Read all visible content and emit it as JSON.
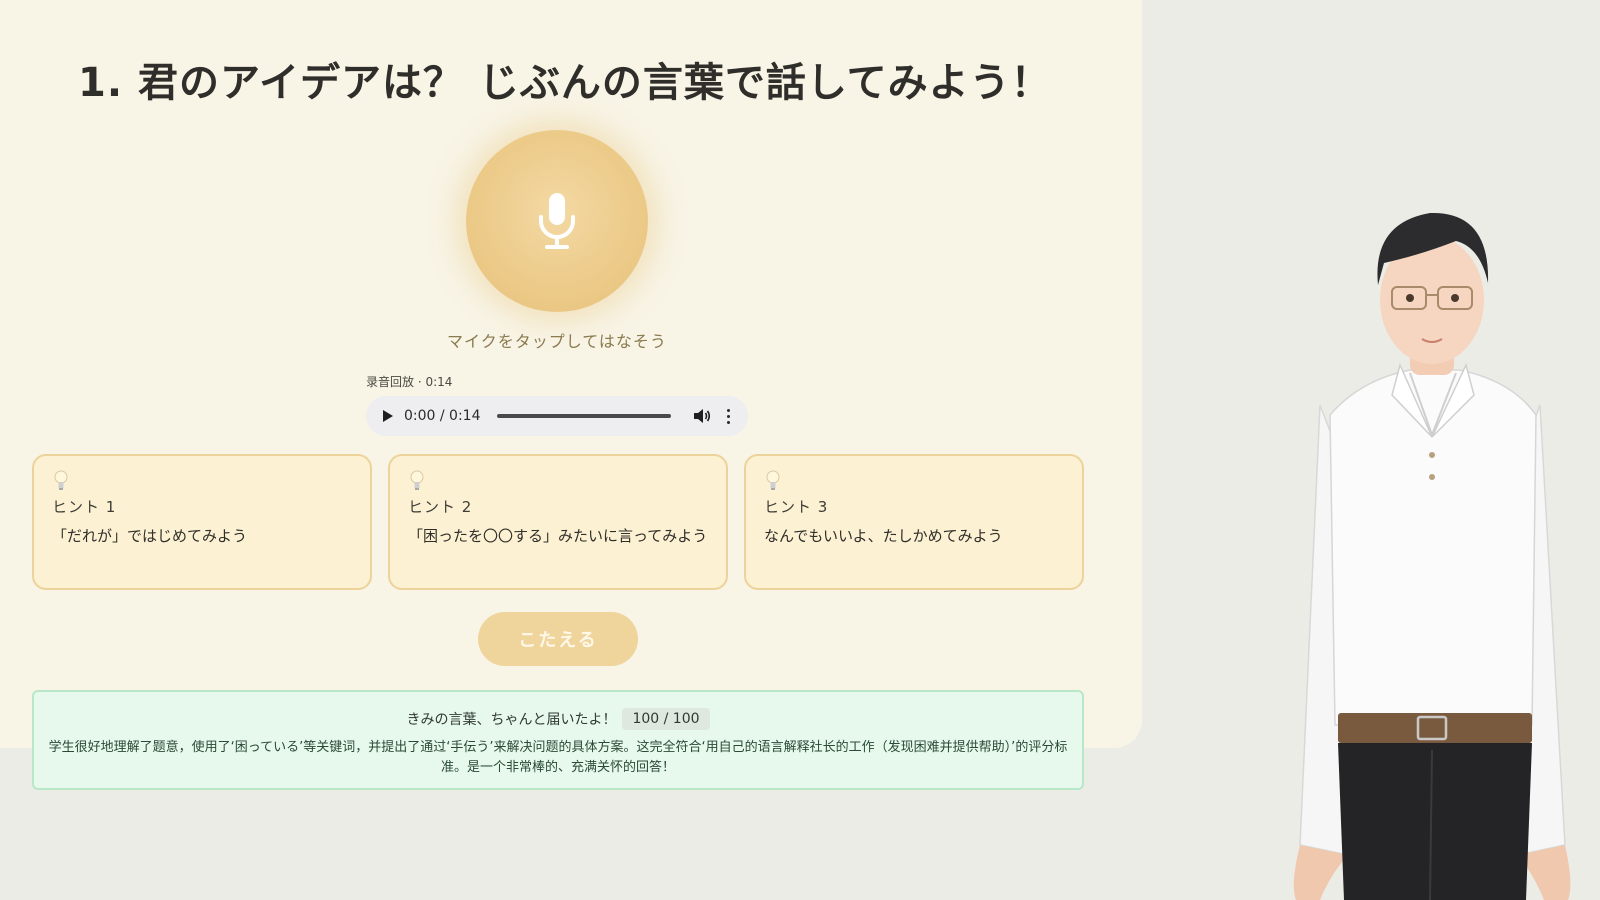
{
  "question": {
    "title": "1. 君のアイデアは？ じぶんの言葉で話してみよう！"
  },
  "mic": {
    "hint": "マイクをタップしてはなそう"
  },
  "recording": {
    "label": "录音回放 · 0:14",
    "time_display": "0:00 / 0:14"
  },
  "hints": [
    {
      "number": "ヒント 1",
      "text": "「だれが」ではじめてみよう"
    },
    {
      "number": "ヒント 2",
      "text": "「困ったを〇〇する」みたいに言ってみよう"
    },
    {
      "number": "ヒント 3",
      "text": "なんでもいいよ、たしかめてみよう"
    }
  ],
  "answer_button": {
    "label": "こたえる"
  },
  "result": {
    "headline": "きみの言葉、ちゃんと届いたよ！",
    "score": "100 / 100",
    "feedback": "学生很好地理解了题意，使用了‘困っている’等关键词，并提出了通过‘手伝う’来解决问题的具体方案。这完全符合‘用自己的语言解释社长的工作（发现困难并提供帮助）’的评分标准。是一个非常棒的、充满关怀的回答！"
  }
}
